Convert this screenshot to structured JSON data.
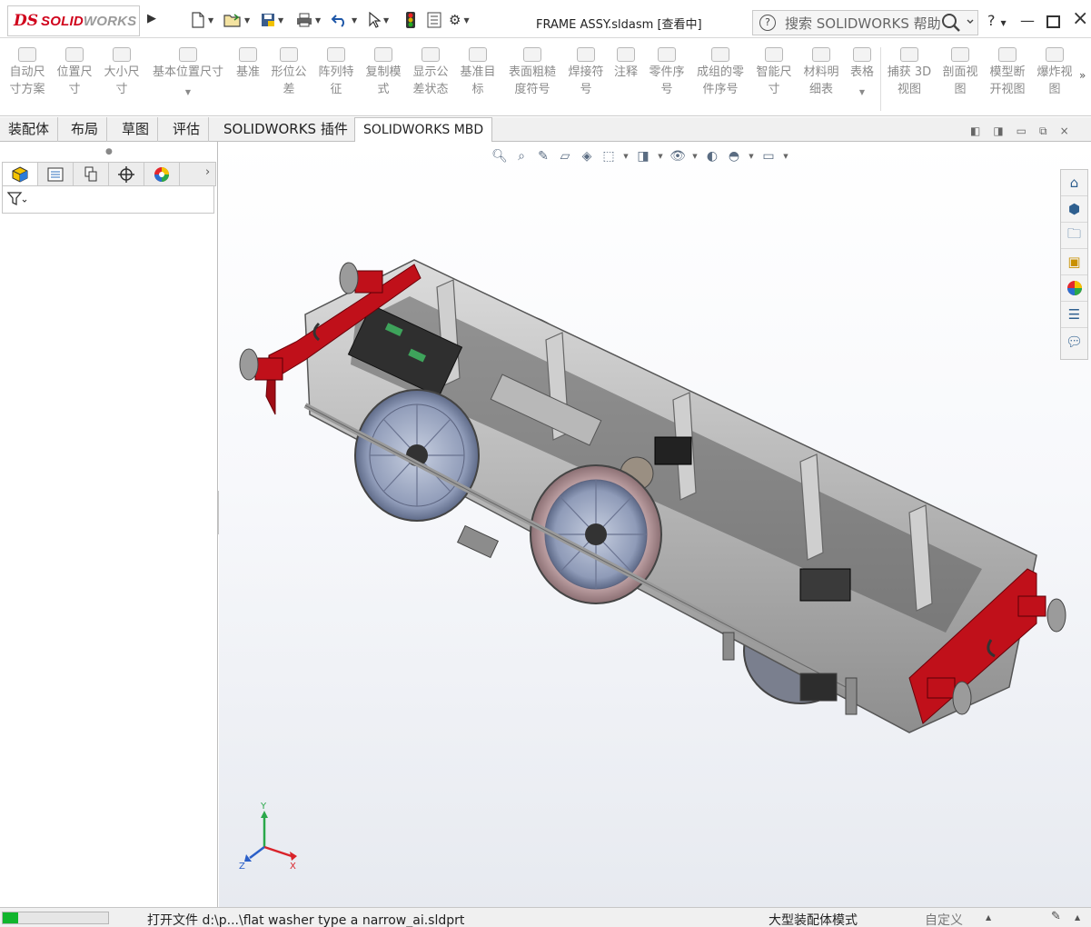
{
  "app": {
    "logo_prefix": "DS",
    "logo_text_1": "SOLID",
    "logo_text_2": "WORKS",
    "document_title": "FRAME ASSY.sldasm [查看中]"
  },
  "search": {
    "placeholder": "搜索 SOLIDWORKS 帮助"
  },
  "window_controls": {
    "help": "?",
    "minimize": "—",
    "close": "×"
  },
  "command_manager": [
    {
      "label": "自动尺\n寸方案",
      "icon": "auto-dimension-icon"
    },
    {
      "label": "位置尺\n寸",
      "icon": "location-dimension-icon"
    },
    {
      "label": "大小尺\n寸",
      "icon": "size-dimension-icon"
    },
    {
      "label": "基本位置尺寸",
      "icon": "basic-location-dimension-icon"
    },
    {
      "label": "基准",
      "icon": "datum-icon"
    },
    {
      "label": "形位公\n差",
      "icon": "geometric-tolerance-icon"
    },
    {
      "label": "阵列特\n征",
      "icon": "pattern-feature-icon"
    },
    {
      "label": "复制模\n式",
      "icon": "copy-scheme-icon"
    },
    {
      "label": "显示公\n差状态",
      "icon": "show-tolerance-status-icon"
    },
    {
      "label": "基准目\n标",
      "icon": "datum-target-icon"
    },
    {
      "label": "表面粗糙\n度符号",
      "icon": "surface-finish-icon"
    },
    {
      "label": "焊接符\n号",
      "icon": "weld-symbol-icon"
    },
    {
      "label": "注释",
      "icon": "note-icon"
    },
    {
      "label": "零件序\n号",
      "icon": "balloon-icon"
    },
    {
      "label": "成组的零\n件序号",
      "icon": "stacked-balloon-icon"
    },
    {
      "label": "智能尺\n寸",
      "icon": "smart-dimension-icon"
    },
    {
      "label": "材料明\n细表",
      "icon": "bom-icon"
    },
    {
      "label": "表格",
      "icon": "table-icon"
    },
    {
      "label": "捕获 3D\n视图",
      "icon": "capture-3d-view-icon"
    },
    {
      "label": "剖面视\n图",
      "icon": "section-view-icon"
    },
    {
      "label": "模型断\n开视图",
      "icon": "model-break-view-icon"
    },
    {
      "label": "爆炸视\n图",
      "icon": "exploded-view-icon"
    }
  ],
  "tabs": [
    "装配体",
    "布局",
    "草图",
    "评估",
    "SOLIDWORKS 插件",
    "SOLIDWORKS MBD"
  ],
  "active_tab": "SOLIDWORKS MBD",
  "triad": {
    "x": "X",
    "y": "Y",
    "z": "Z"
  },
  "status": {
    "progress": 0.15,
    "message": "打开文件 d:\\p...\\flat washer type a narrow_ai.sldprt",
    "mode": "大型装配体模式",
    "units": "自定义"
  },
  "colors": {
    "brand": "#d0021b",
    "frame_red": "#c0101a",
    "progress": "#11b52d",
    "hud": "#5a6c82"
  }
}
